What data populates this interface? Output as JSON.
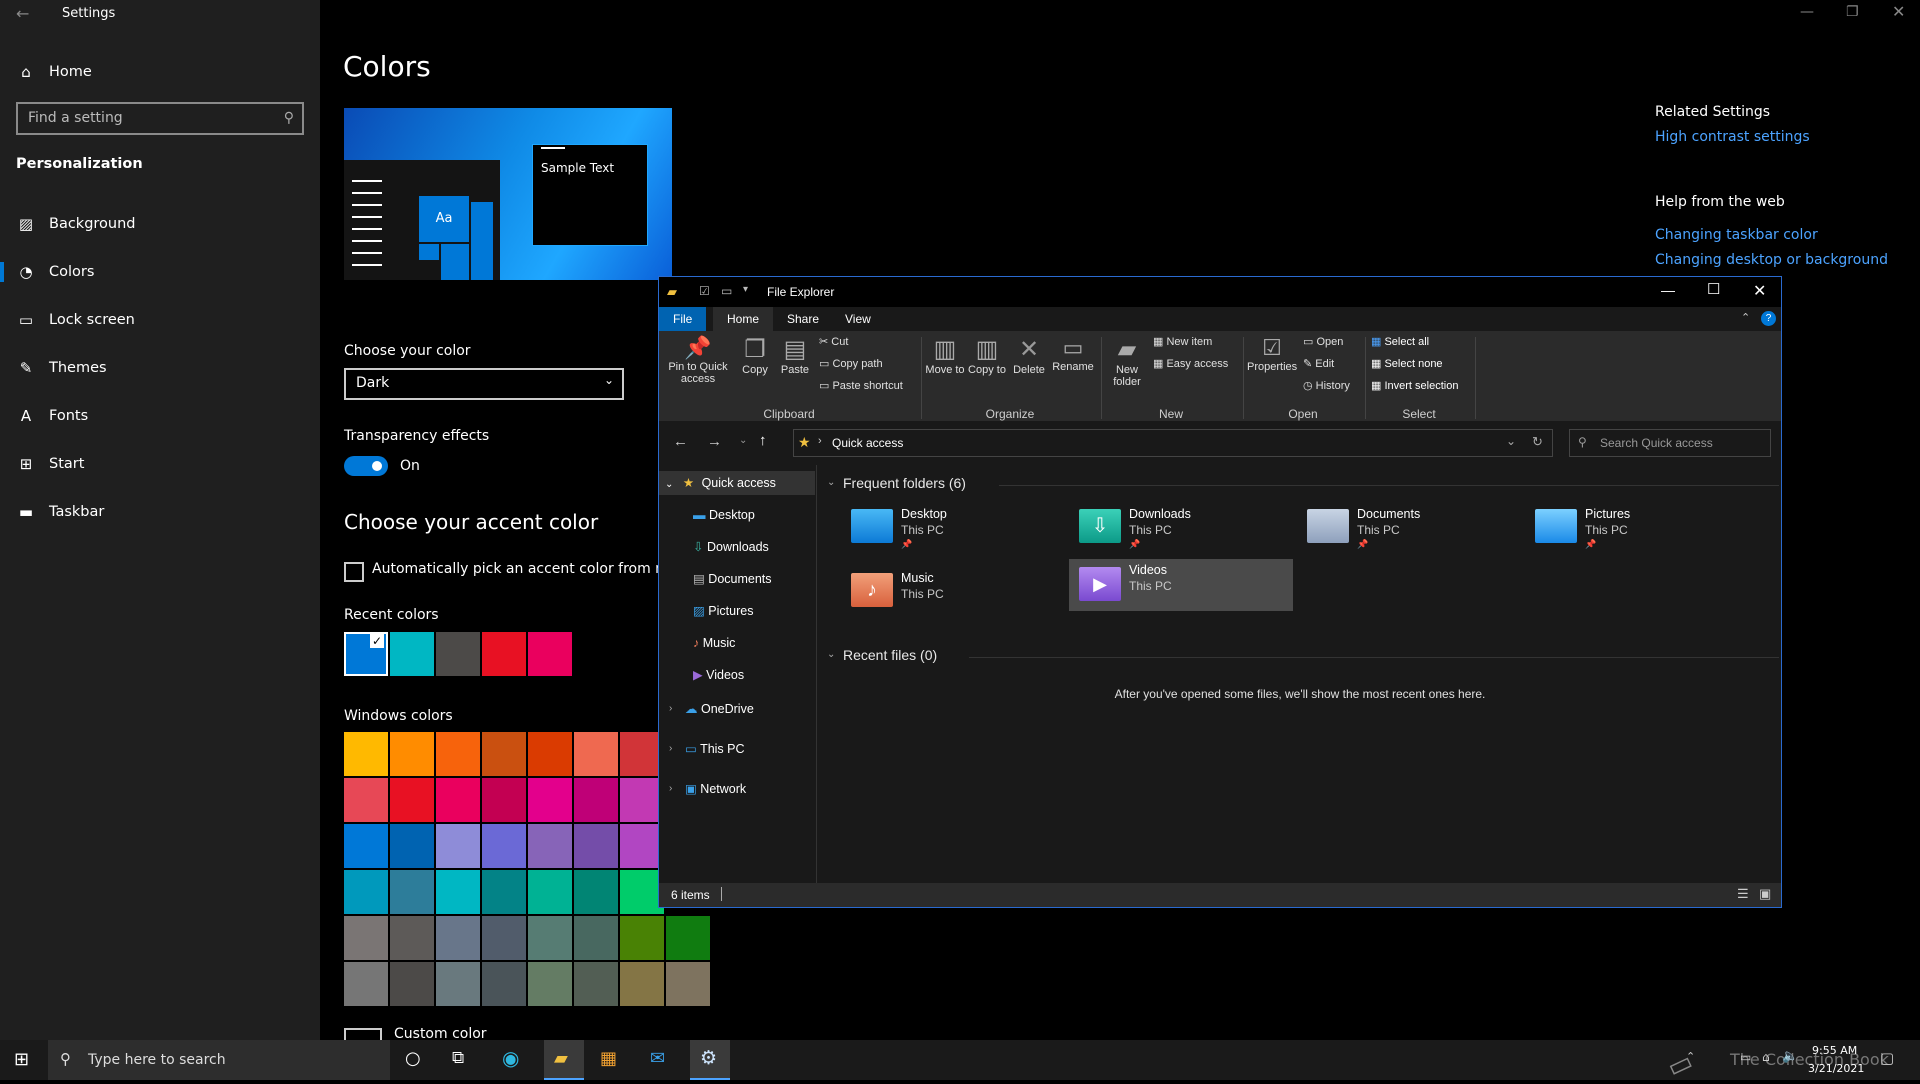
{
  "window": {
    "title": "Settings"
  },
  "sidebar": {
    "home": "Home",
    "search_placeholder": "Find a setting",
    "section": "Personalization",
    "items": [
      {
        "label": "Background",
        "icon": "image-icon"
      },
      {
        "label": "Colors",
        "icon": "palette-icon"
      },
      {
        "label": "Lock screen",
        "icon": "lock-screen-icon"
      },
      {
        "label": "Themes",
        "icon": "brush-icon"
      },
      {
        "label": "Fonts",
        "icon": "font-icon"
      },
      {
        "label": "Start",
        "icon": "start-icon"
      },
      {
        "label": "Taskbar",
        "icon": "taskbar-icon"
      }
    ]
  },
  "main": {
    "title": "Colors",
    "preview_text": "Sample Text",
    "preview_aa": "Aa",
    "choose_color_label": "Choose your color",
    "choose_color_value": "Dark",
    "transparency_label": "Transparency effects",
    "transparency_state": "On",
    "accent_title": "Choose your accent color",
    "auto_pick_label": "Automatically pick an accent color from my ba",
    "recent_label": "Recent colors",
    "recent_colors": [
      "#0078d7",
      "#00b7c3",
      "#4c4a48",
      "#e81123",
      "#ea005e"
    ],
    "windows_label": "Windows colors",
    "windows_colors": [
      [
        "#ffb900",
        "#ff8c00",
        "#f7630c",
        "#ca5010",
        "#da3b01",
        "#ef6950",
        "#d13438"
      ],
      [
        "#e74856",
        "#e81123",
        "#ea005e",
        "#c30052",
        "#e3008c",
        "#bf0077",
        "#c239b3"
      ],
      [
        "#0078d7",
        "#0063b1",
        "#8e8cd8",
        "#6b69d6",
        "#8764b8",
        "#744da9",
        "#b146c2"
      ],
      [
        "#0099bc",
        "#2d7d9a",
        "#00b7c3",
        "#038387",
        "#00b294",
        "#018574",
        "#00cc6a"
      ],
      [
        "#7a7574",
        "#5d5a58",
        "#68768a",
        "#515c6b",
        "#567c73",
        "#486860",
        "#498205",
        "#107c10"
      ],
      [
        "#767676",
        "#4c4a48",
        "#69797e",
        "#4a5459",
        "#647c64",
        "#525e54",
        "#847545",
        "#7e735f"
      ]
    ],
    "custom_label": "Custom color"
  },
  "related": {
    "title": "Related Settings",
    "link1": "High contrast settings",
    "help_title": "Help from the web",
    "link2": "Changing taskbar color",
    "link3": "Changing desktop or background"
  },
  "explorer": {
    "title": "File Explorer",
    "tabs": [
      "File",
      "Home",
      "Share",
      "View"
    ],
    "ribbon": {
      "pin": "Pin to Quick access",
      "copy": "Copy",
      "paste": "Paste",
      "cut": "Cut",
      "copy_path": "Copy path",
      "paste_shortcut": "Paste shortcut",
      "clipboard": "Clipboard",
      "move_to": "Move to",
      "copy_to": "Copy to",
      "delete": "Delete",
      "rename": "Rename",
      "organize": "Organize",
      "new_folder": "New folder",
      "new_item": "New item",
      "easy_access": "Easy access",
      "new": "New",
      "properties": "Properties",
      "open": "Open",
      "edit": "Edit",
      "history": "History",
      "open_group": "Open",
      "select_all": "Select all",
      "select_none": "Select none",
      "invert_selection": "Invert selection",
      "select": "Select"
    },
    "address": "Quick access",
    "search_placeholder": "Search Quick access",
    "nav": {
      "quick_access": "Quick access",
      "items": [
        "Desktop",
        "Downloads",
        "Documents",
        "Pictures",
        "Music",
        "Videos"
      ],
      "onedrive": "OneDrive",
      "this_pc": "This PC",
      "network": "Network"
    },
    "frequent_title": "Frequent folders (6)",
    "folders": [
      {
        "name": "Desktop",
        "sub": "This PC"
      },
      {
        "name": "Downloads",
        "sub": "This PC"
      },
      {
        "name": "Documents",
        "sub": "This PC"
      },
      {
        "name": "Pictures",
        "sub": "This PC"
      },
      {
        "name": "Music",
        "sub": "This PC"
      },
      {
        "name": "Videos",
        "sub": "This PC"
      }
    ],
    "recent_title": "Recent files (0)",
    "recent_empty": "After you've opened some files, we'll show the most recent ones here.",
    "status": "6 items"
  },
  "taskbar": {
    "search_placeholder": "Type here to search",
    "time": "9:55 AM",
    "date": "3/21/2021",
    "watermark": "The Collection Book"
  }
}
